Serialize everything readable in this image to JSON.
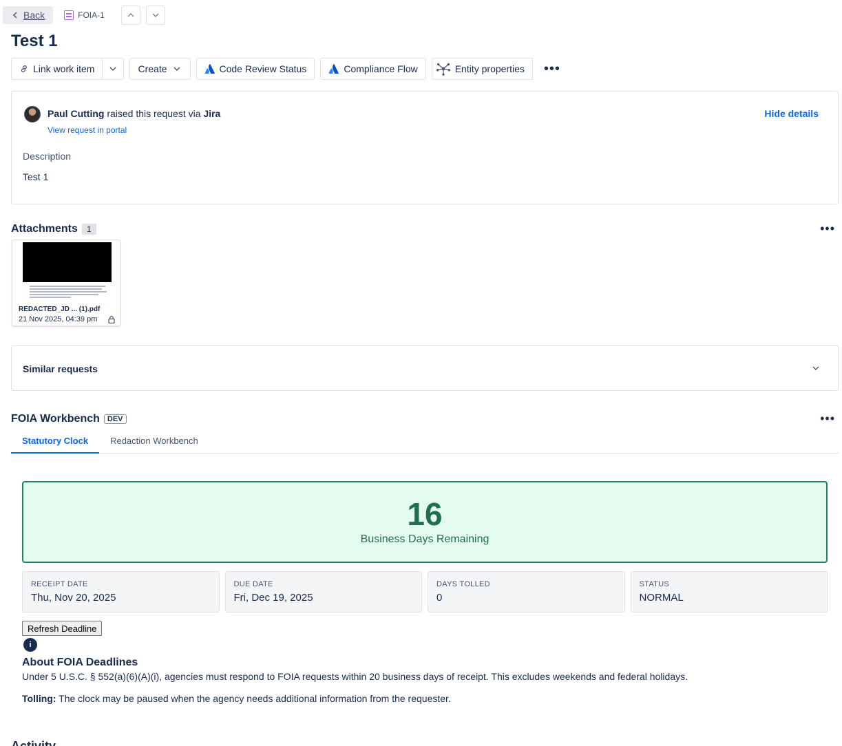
{
  "topbar": {
    "back_label": "Back",
    "issue_key": "FOIA-1"
  },
  "page_title": "Test 1",
  "actions": {
    "link_work_item": "Link work item",
    "create": "Create",
    "code_review_status": "Code Review Status",
    "compliance_flow": "Compliance Flow",
    "entity_properties": "Entity properties"
  },
  "request": {
    "reporter": "Paul Cutting",
    "raised_text": "raised this request via",
    "channel": "Jira",
    "view_portal": "View request in portal",
    "hide_details": "Hide details",
    "description_label": "Description",
    "description_text": "Test 1"
  },
  "attachments": {
    "title": "Attachments",
    "count": "1",
    "items": [
      {
        "filename": "REDACTED_JD ... (1).pdf",
        "date": "21 Nov 2025, 04:39 pm"
      }
    ]
  },
  "similar": {
    "title": "Similar requests"
  },
  "workbench": {
    "title": "FOIA Workbench",
    "badge": "DEV",
    "tabs": [
      {
        "label": "Statutory Clock",
        "active": true
      },
      {
        "label": "Redaction Workbench",
        "active": false
      }
    ],
    "clock": {
      "days": "16",
      "label": "Business Days Remaining"
    },
    "stats": [
      {
        "label": "RECEIPT DATE",
        "value": "Thu, Nov 20, 2025"
      },
      {
        "label": "DUE DATE",
        "value": "Fri, Dec 19, 2025"
      },
      {
        "label": "DAYS TOLLED",
        "value": "0"
      },
      {
        "label": "STATUS",
        "value": "NORMAL"
      }
    ],
    "refresh_label": "Refresh Deadline",
    "info_glyph": "i",
    "about_title": "About FOIA Deadlines",
    "about_text": "Under 5 U.S.C. § 552(a)(6)(A)(i), agencies must respond to FOIA requests within 20 business days of receipt. This excludes weekends and federal holidays.",
    "tolling_label": "Tolling:",
    "tolling_text": " The clock may be paused when the agency needs additional information from the requester."
  },
  "activity_title": "Activity",
  "colors": {
    "accent": "#0c66e4",
    "success_border": "#1f845a",
    "success_bg": "#e3fcef",
    "success_text": "#216e4e",
    "issue_type": "#a66ad8"
  }
}
